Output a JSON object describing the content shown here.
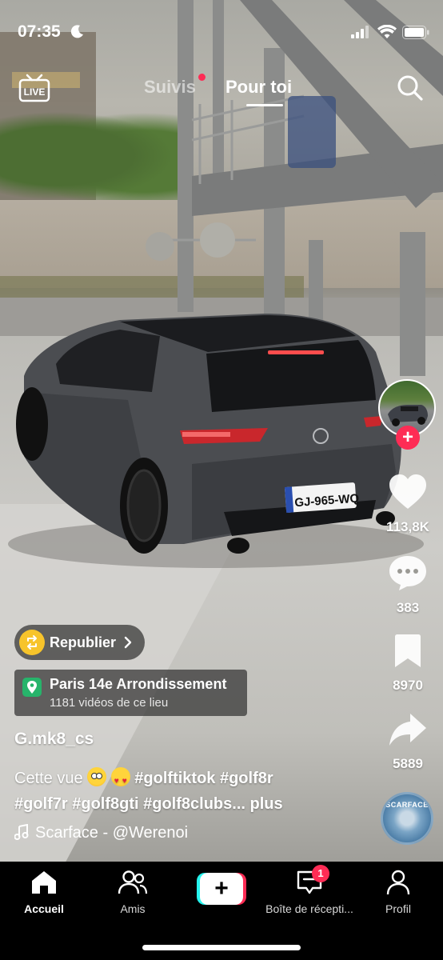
{
  "status_bar": {
    "time": "07:35"
  },
  "top_nav": {
    "live_label": "LIVE",
    "following_tab": "Suivis",
    "for_you_tab": "Pour toi"
  },
  "video": {
    "license_plate": "GJ-965-WQ"
  },
  "actions": {
    "likes": "113,8K",
    "comments": "383",
    "saves": "8970",
    "shares": "5889"
  },
  "repost": {
    "label": "Republier"
  },
  "location": {
    "title": "Paris 14e Arrondissement",
    "subtitle": "1181 vidéos de ce lieu"
  },
  "post": {
    "username": "G.mk8_cs",
    "caption_text": "Cette vue",
    "hashtags_line1": "#golftiktok #golf8r",
    "hashtags_line2": "#golf7r #golf8gti #golf8clubs...",
    "more_label": "plus",
    "sound": "Scarface - @Werenoi",
    "disc_label": "SCARFACE"
  },
  "tab_bar": {
    "home": "Accueil",
    "friends": "Amis",
    "inbox": "Boîte de récepti...",
    "inbox_badge": "1",
    "profile": "Profil"
  },
  "colors": {
    "accent": "#fe2c55",
    "cyan": "#25f4ee",
    "repost_icon": "#f7c42b",
    "location_pin": "#27b46b"
  }
}
